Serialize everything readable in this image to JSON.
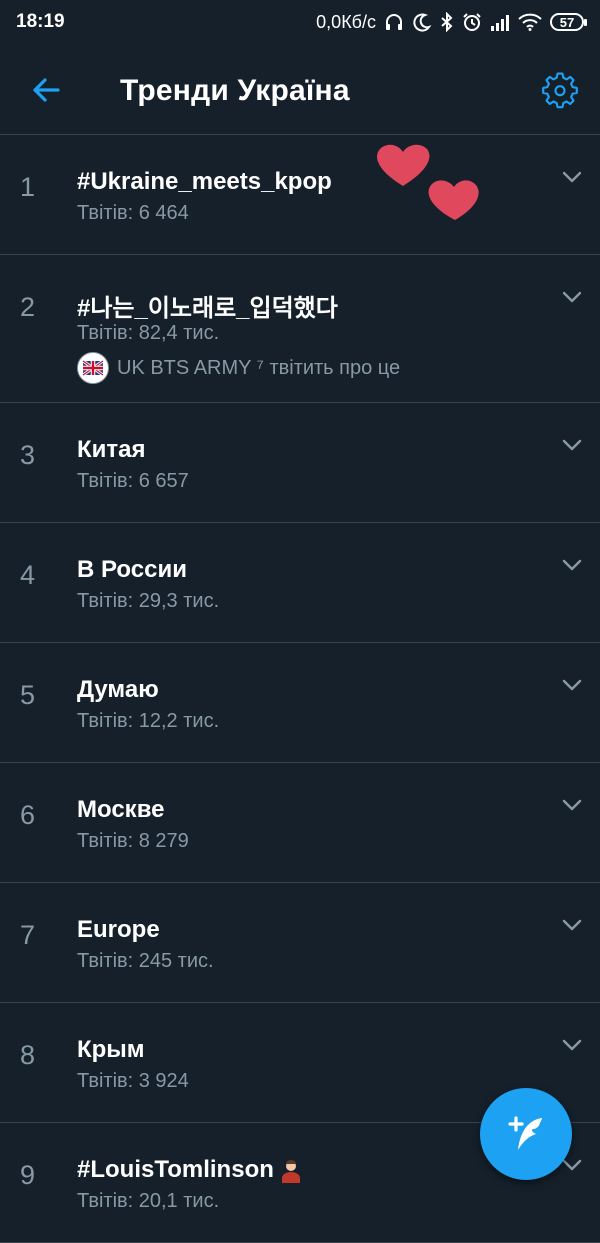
{
  "status_bar": {
    "time": "18:19",
    "network_speed": "0,0Кб/с",
    "battery": "57",
    "icons": [
      "headphones-icon",
      "moon-icon",
      "bluetooth-icon",
      "alarm-icon",
      "signal-icon",
      "wifi-icon",
      "battery-icon"
    ]
  },
  "header": {
    "title": "Тренди Україна",
    "back_icon": "back-arrow-icon",
    "settings_icon": "gear-icon"
  },
  "trends": [
    {
      "rank": "1",
      "name": "#Ukraine_meets_kpop",
      "count": "Твітів: 6 464"
    },
    {
      "rank": "2",
      "name": "#나는_이노래로_입덕했다",
      "count": "Твітів: 82,4 тис.",
      "context": "UK BTS ARMY ⁷ твітить про це"
    },
    {
      "rank": "3",
      "name": "Китая",
      "count": "Твітів: 6 657"
    },
    {
      "rank": "4",
      "name": "В России",
      "count": "Твітів: 29,3 тис."
    },
    {
      "rank": "5",
      "name": "Думаю",
      "count": "Твітів: 12,2 тис."
    },
    {
      "rank": "6",
      "name": "Москве",
      "count": "Твітів: 8 279"
    },
    {
      "rank": "7",
      "name": "Europe",
      "count": "Твітів: 245 тис."
    },
    {
      "rank": "8",
      "name": "Крым",
      "count": "Твітів: 3 924"
    },
    {
      "rank": "9",
      "name": "#LouisTomlinson",
      "count": "Твітів: 20,1 тис."
    }
  ],
  "colors": {
    "background": "#15202b",
    "accent": "#1da1f2",
    "secondary_text": "#8899a6",
    "divider": "#38444d",
    "heart": "#e0485d"
  },
  "fab": {
    "icon": "compose-tweet-icon"
  }
}
